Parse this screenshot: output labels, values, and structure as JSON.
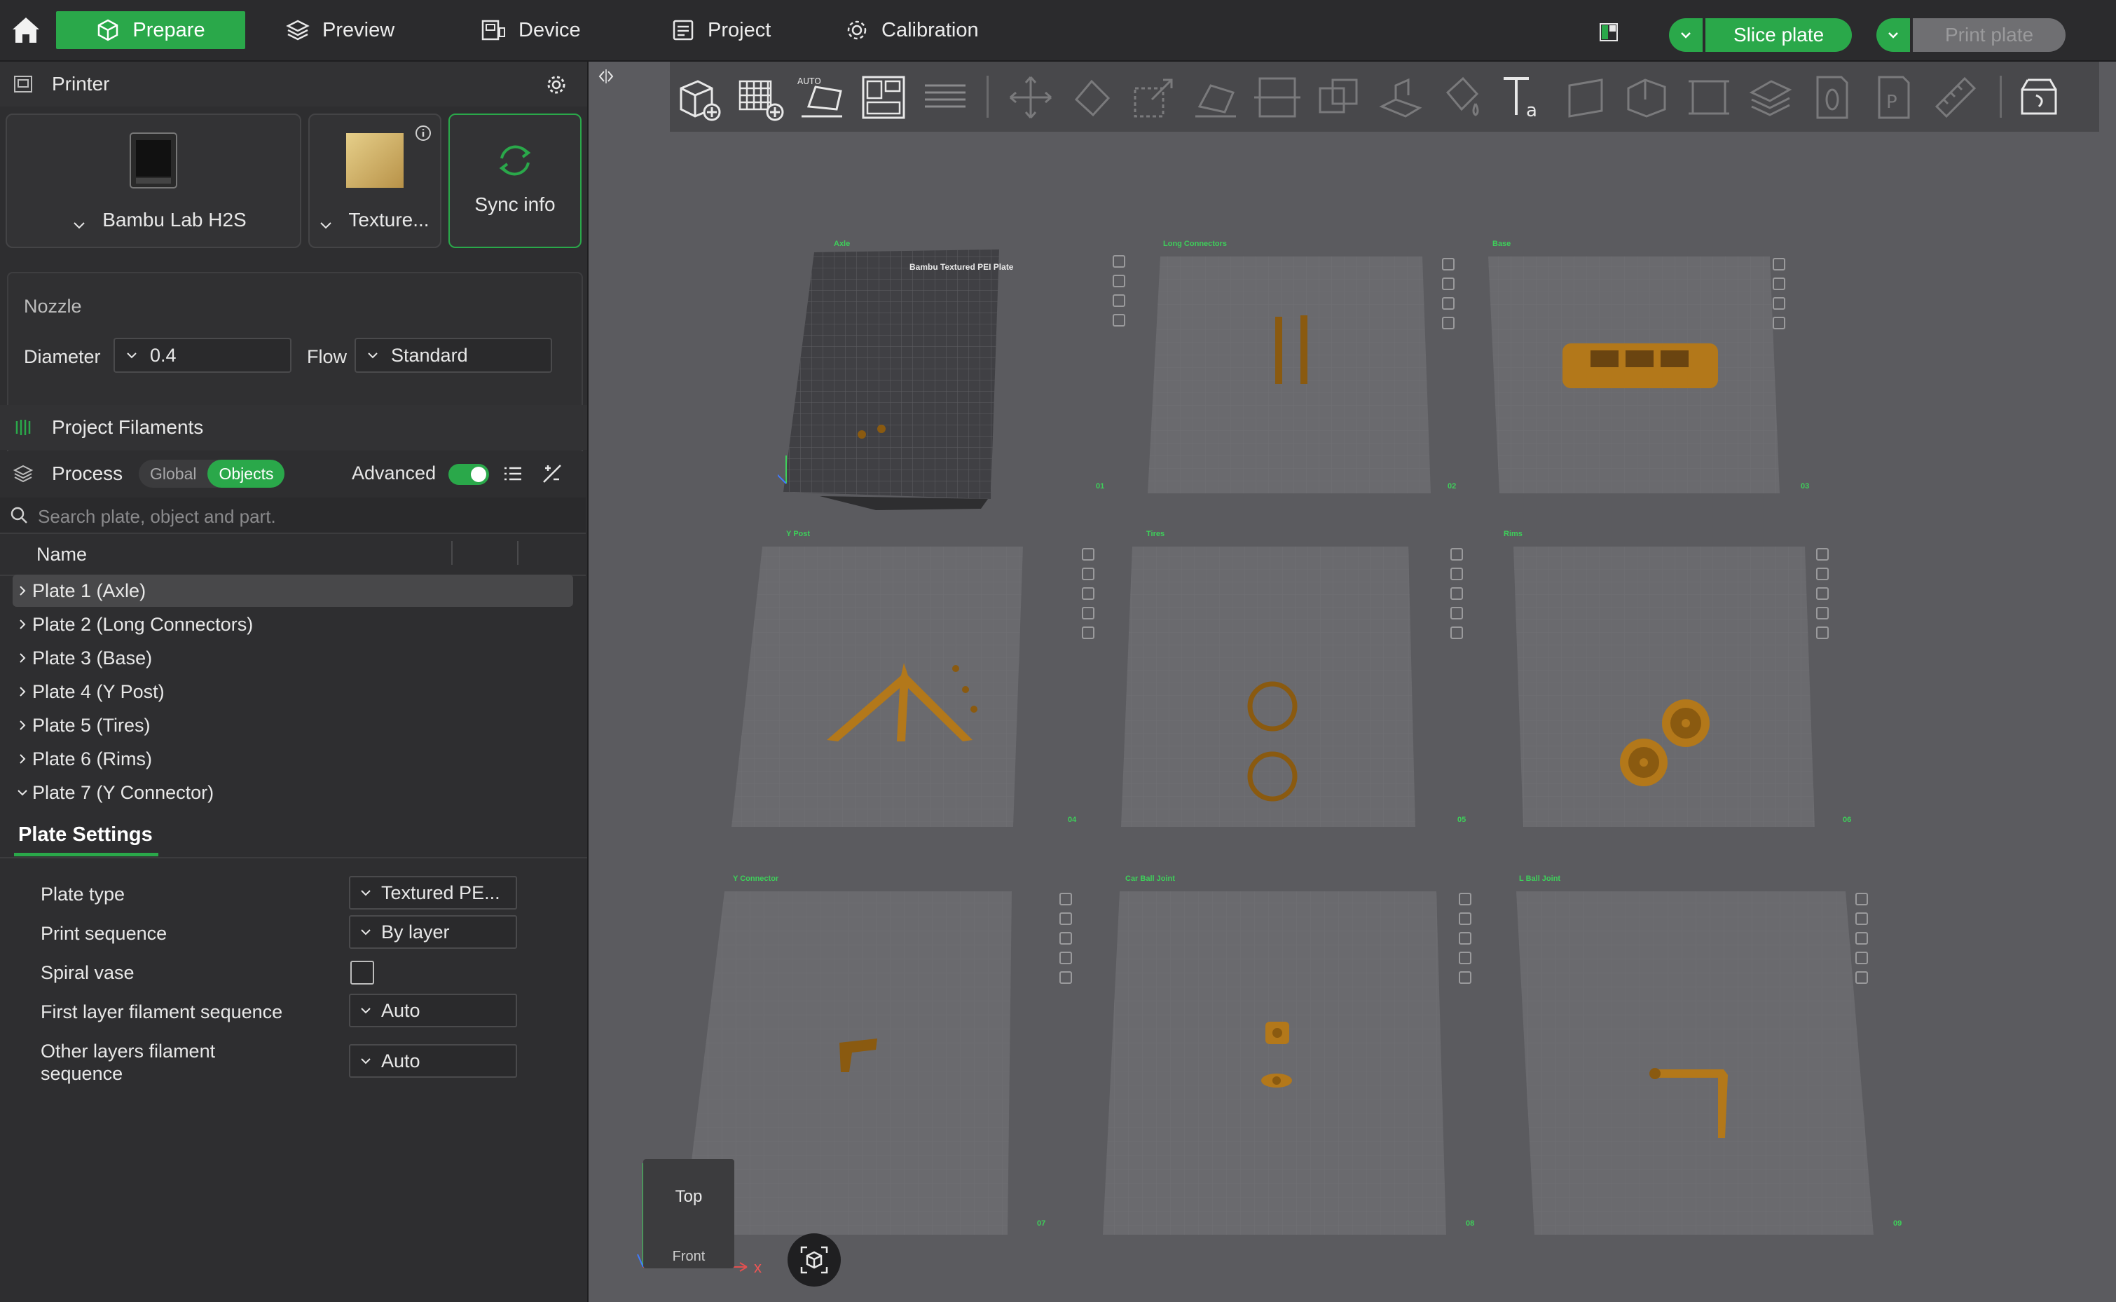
{
  "topbar": {
    "tabs": [
      {
        "label": "Prepare",
        "icon": "cube-outline-icon"
      },
      {
        "label": "Preview",
        "icon": "layers-icon"
      },
      {
        "label": "Device",
        "icon": "device-icon"
      },
      {
        "label": "Project",
        "icon": "project-icon"
      },
      {
        "label": "Calibration",
        "icon": "calibration-icon"
      }
    ],
    "slice_label": "Slice plate",
    "print_label": "Print plate",
    "accent": "#2aa84a"
  },
  "printer": {
    "title": "Printer",
    "printer_name": "Bambu Lab H2S",
    "plate_name": "Texture...",
    "sync_label": "Sync info"
  },
  "nozzle": {
    "title": "Nozzle",
    "diameter_label": "Diameter",
    "diameter_value": "0.4",
    "flow_label": "Flow",
    "flow_value": "Standard"
  },
  "filaments": {
    "title": "Project Filaments"
  },
  "process": {
    "title": "Process",
    "global_label": "Global",
    "objects_label": "Objects",
    "advanced_label": "Advanced"
  },
  "search": {
    "placeholder": "Search plate, object and part."
  },
  "tree": {
    "name_header": "Name",
    "rows": [
      "Plate 1 (Axle)",
      "Plate 2 (Long Connectors)",
      "Plate 3 (Base)",
      "Plate 4 (Y Post)",
      "Plate 5 (Tires)",
      "Plate 6 (Rims)",
      "Plate 7 (Y Connector)"
    ]
  },
  "plate_settings": {
    "tab_label": "Plate Settings",
    "plate_type_label": "Plate type",
    "plate_type_value": "Textured PE...",
    "print_sequence_label": "Print sequence",
    "print_sequence_value": "By layer",
    "spiral_vase_label": "Spiral vase",
    "first_layer_label": "First layer filament sequence",
    "first_layer_value": "Auto",
    "other_layers_label_1": "Other layers filament",
    "other_layers_label_2": "sequence",
    "other_layers_value": "Auto"
  },
  "viewport": {
    "first_plate_caption": "Bambu Textured PEI Plate",
    "plates": [
      {
        "name": "Axle",
        "num": "01"
      },
      {
        "name": "Long Connectors",
        "num": "02"
      },
      {
        "name": "Base",
        "num": "03"
      },
      {
        "name": "Y Post",
        "num": "04"
      },
      {
        "name": "Tires",
        "num": "05"
      },
      {
        "name": "Rims",
        "num": "06"
      },
      {
        "name": "Y Connector",
        "num": "07"
      },
      {
        "name": "Car Ball Joint",
        "num": "08"
      },
      {
        "name": "L Ball Joint",
        "num": "09"
      }
    ],
    "view_cube_top": "Top",
    "view_cube_front": "Front",
    "axis_x": "x"
  }
}
